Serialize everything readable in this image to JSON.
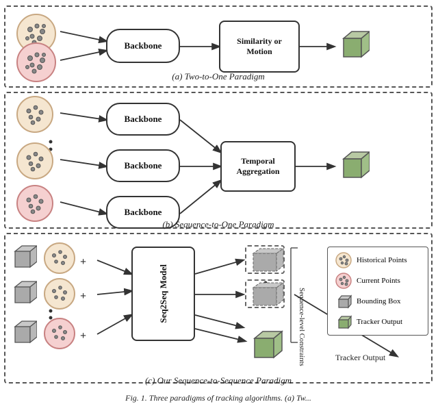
{
  "sections": {
    "a": {
      "caption": "(a) Two-to-One Paradigm",
      "backbone_label": "Backbone",
      "sim_motion_label": "Similarity or\nMotion"
    },
    "b": {
      "caption": "(b) Sequence-to-One Paradigm",
      "backbone_label": "Backbone",
      "temporal_label": "Temporal\nAggregation"
    },
    "c": {
      "caption": "(c) Our Sequence-to-Sequence Paradigm",
      "seq2seq_label": "Seq2Seq Model",
      "seq_constraints_label": "Sequence-level\nConstraints",
      "tracker_output_label": "Tracker Output"
    }
  },
  "legend": {
    "items": [
      {
        "key": "historical",
        "label": "Historical Points"
      },
      {
        "key": "current",
        "label": "Current Points"
      },
      {
        "key": "bbox",
        "label": "Bounding Box"
      },
      {
        "key": "tracker",
        "label": "Tracker Output"
      }
    ]
  }
}
